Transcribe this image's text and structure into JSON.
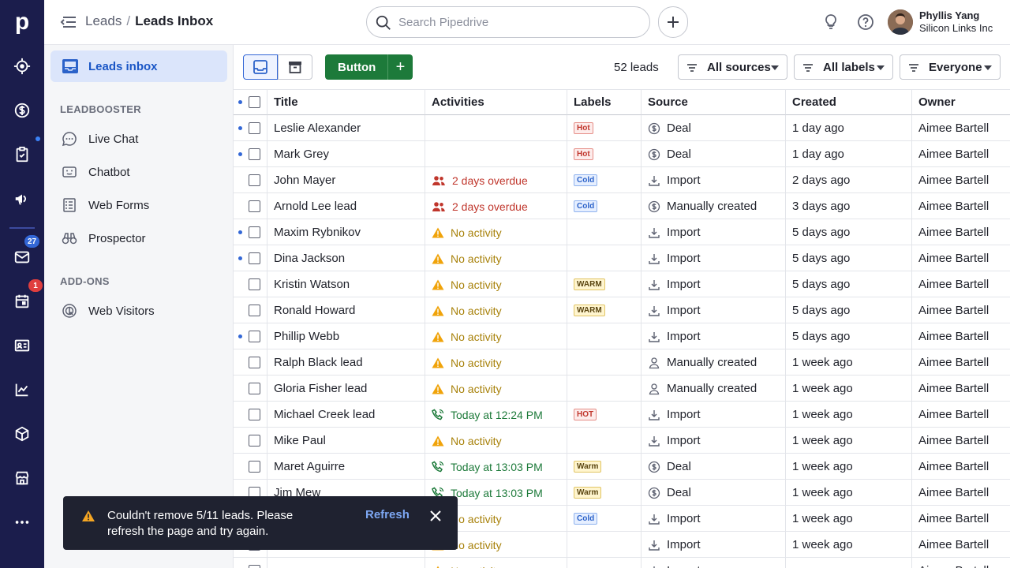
{
  "app": {
    "logo_letter": "p",
    "accent": "#1b1d4c"
  },
  "rail": {
    "items": [
      {
        "name": "target-icon"
      },
      {
        "name": "deals-dollar-icon"
      },
      {
        "name": "tasks-clipboard-icon"
      },
      {
        "name": "campaigns-megaphone-icon"
      },
      {
        "name": "mail-icon",
        "badge": "27"
      },
      {
        "name": "calendar-icon",
        "badge": "1"
      },
      {
        "name": "contacts-card-icon"
      },
      {
        "name": "insights-chart-icon"
      },
      {
        "name": "products-box-icon"
      },
      {
        "name": "marketplace-store-icon"
      },
      {
        "name": "more-icon"
      }
    ]
  },
  "header": {
    "breadcrumb_parent": "Leads",
    "breadcrumb_sep": "/",
    "breadcrumb_current": "Leads Inbox",
    "search_placeholder": "Search Pipedrive",
    "user_name": "Phyllis Yang",
    "user_company": "Silicon Links Inc"
  },
  "sidebar": {
    "active_item": "Leads inbox",
    "section1": "LEADBOOSTER",
    "section1_items": [
      "Live Chat",
      "Chatbot",
      "Web Forms",
      "Prospector"
    ],
    "section2": "ADD-ONS",
    "section2_items": [
      "Web Visitors"
    ]
  },
  "toolbar": {
    "button_label": "Button",
    "plus_label": "+",
    "lead_count": "52 leads",
    "filters": [
      "All sources",
      "All labels",
      "Everyone"
    ]
  },
  "table": {
    "columns": [
      "Title",
      "Activities",
      "Labels",
      "Source",
      "Created",
      "Owner"
    ],
    "rows": [
      {
        "unread": true,
        "title": "Leslie Alexander",
        "activity": "",
        "activity_type": "",
        "label": "Hot",
        "label_type": "hot",
        "source": "Deal",
        "source_icon": "dollar",
        "created": "1 day ago",
        "owner": "Aimee Bartell"
      },
      {
        "unread": true,
        "title": "Mark Grey",
        "activity": "",
        "activity_type": "",
        "label": "Hot",
        "label_type": "hot",
        "source": "Deal",
        "source_icon": "dollar",
        "created": "1 day ago",
        "owner": "Aimee Bartell"
      },
      {
        "unread": false,
        "title": "John Mayer",
        "activity": "2 days overdue",
        "activity_type": "overdue",
        "label": "Cold",
        "label_type": "cold",
        "source": "Import",
        "source_icon": "import",
        "created": "2 days ago",
        "owner": "Aimee Bartell"
      },
      {
        "unread": false,
        "title": "Arnold Lee lead",
        "activity": "2 days overdue",
        "activity_type": "overdue",
        "label": "Cold",
        "label_type": "cold",
        "source": "Manually created",
        "source_icon": "dollar",
        "created": "3 days ago",
        "owner": "Aimee Bartell"
      },
      {
        "unread": true,
        "title": "Maxim Rybnikov",
        "activity": "No activity",
        "activity_type": "none",
        "label": "",
        "label_type": "",
        "source": "Import",
        "source_icon": "import",
        "created": "5 days ago",
        "owner": "Aimee Bartell"
      },
      {
        "unread": true,
        "title": "Dina Jackson",
        "activity": "No activity",
        "activity_type": "none",
        "label": "",
        "label_type": "",
        "source": "Import",
        "source_icon": "import",
        "created": "5 days ago",
        "owner": "Aimee Bartell"
      },
      {
        "unread": false,
        "title": "Kristin Watson",
        "activity": "No activity",
        "activity_type": "none",
        "label": "WARM",
        "label_type": "warm",
        "source": "Import",
        "source_icon": "import",
        "created": "5 days ago",
        "owner": "Aimee Bartell"
      },
      {
        "unread": false,
        "title": "Ronald Howard",
        "activity": "No activity",
        "activity_type": "none",
        "label": "WARM",
        "label_type": "warm",
        "source": "Import",
        "source_icon": "import",
        "created": "5 days ago",
        "owner": "Aimee Bartell"
      },
      {
        "unread": true,
        "title": "Phillip Webb",
        "activity": "No activity",
        "activity_type": "none",
        "label": "",
        "label_type": "",
        "source": "Import",
        "source_icon": "import",
        "created": "5 days ago",
        "owner": "Aimee Bartell"
      },
      {
        "unread": false,
        "title": "Ralph Black lead",
        "activity": "No activity",
        "activity_type": "none",
        "label": "",
        "label_type": "",
        "source": "Manually created",
        "source_icon": "person",
        "created": "1 week ago",
        "owner": "Aimee Bartell"
      },
      {
        "unread": false,
        "title": "Gloria Fisher lead",
        "activity": "No activity",
        "activity_type": "none",
        "label": "",
        "label_type": "",
        "source": "Manually created",
        "source_icon": "person",
        "created": "1 week ago",
        "owner": "Aimee Bartell"
      },
      {
        "unread": false,
        "title": "Michael Creek lead",
        "activity": "Today at 12:24 PM",
        "activity_type": "today",
        "label": "HOT",
        "label_type": "hot",
        "source": "Import",
        "source_icon": "import",
        "created": "1 week ago",
        "owner": "Aimee Bartell"
      },
      {
        "unread": false,
        "title": "Mike Paul",
        "activity": "No activity",
        "activity_type": "none",
        "label": "",
        "label_type": "",
        "source": "Import",
        "source_icon": "import",
        "created": "1 week ago",
        "owner": "Aimee Bartell"
      },
      {
        "unread": false,
        "title": "Maret Aguirre",
        "activity": "Today at 13:03 PM",
        "activity_type": "today",
        "label": "Warm",
        "label_type": "warm",
        "source": "Deal",
        "source_icon": "dollar",
        "created": "1 week ago",
        "owner": "Aimee Bartell"
      },
      {
        "unread": false,
        "title": "Jim Mew",
        "activity": "Today at 13:03 PM",
        "activity_type": "today",
        "label": "Warm",
        "label_type": "warm",
        "source": "Deal",
        "source_icon": "dollar",
        "created": "1 week ago",
        "owner": "Aimee Bartell"
      },
      {
        "unread": false,
        "title": "",
        "activity": "No activity",
        "activity_type": "none",
        "label": "Cold",
        "label_type": "cold",
        "source": "Import",
        "source_icon": "import",
        "created": "1 week ago",
        "owner": "Aimee Bartell"
      },
      {
        "unread": false,
        "title": "",
        "activity": "No activity",
        "activity_type": "none",
        "label": "",
        "label_type": "",
        "source": "Import",
        "source_icon": "import",
        "created": "1 week ago",
        "owner": "Aimee Bartell"
      },
      {
        "unread": false,
        "title": "",
        "activity": "No activity",
        "activity_type": "none",
        "label": "",
        "label_type": "",
        "source": "Import",
        "source_icon": "import",
        "created": "",
        "owner": "Aimee Bartell"
      }
    ]
  },
  "toast": {
    "message": "Couldn't remove 5/11 leads. Please refresh the page and try again.",
    "action": "Refresh"
  }
}
